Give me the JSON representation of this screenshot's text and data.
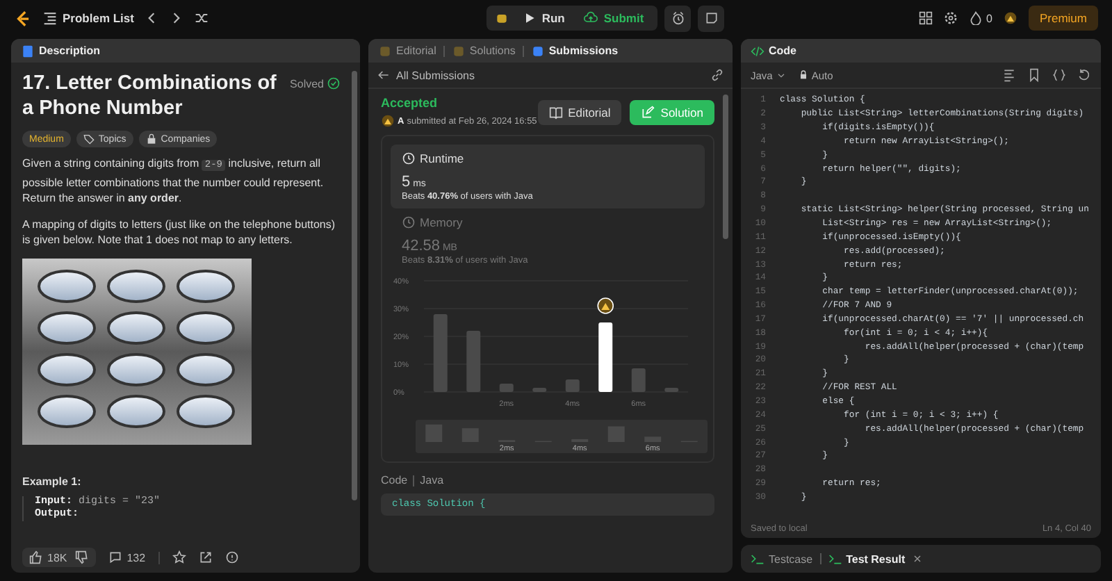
{
  "topbar": {
    "problem_list": "Problem List",
    "run": "Run",
    "submit": "Submit",
    "streak": "0",
    "premium": "Premium"
  },
  "description": {
    "tab": "Description",
    "title": "17. Letter Combinations of a Phone Number",
    "solved": "Solved",
    "tags": [
      {
        "label": "Medium",
        "kind": "difficulty"
      },
      {
        "label": "Topics",
        "kind": "topics"
      },
      {
        "label": "Companies",
        "kind": "companies"
      }
    ],
    "paragraphs": [
      [
        {
          "kind": "text",
          "text": "Given a string containing digits from "
        },
        {
          "kind": "code",
          "text": "2-9"
        },
        {
          "kind": "text",
          "text": " inclusive, return all possible letter combinations that the number could represent. Return the answer in **any order**."
        }
      ],
      [
        {
          "kind": "text",
          "text": "A mapping of digits to letters (just like on the telephone buttons) is given below. Note that 1 does not map to any letters."
        }
      ]
    ],
    "example_title": "Example 1:",
    "example_lines": [
      {
        "label": "Input:",
        "value": "digits = \"23\""
      },
      {
        "label": "Output:"
      }
    ],
    "likes": "18K",
    "comments": "132"
  },
  "submission": {
    "tabs": [
      {
        "label": "Editorial",
        "selected": false
      },
      {
        "label": "Solutions",
        "selected": false
      },
      {
        "label": "Submissions",
        "selected": true
      }
    ],
    "back": "All Submissions",
    "status": "Accepted",
    "user": "A",
    "submitted_at": "submitted at Feb 26, 2024 16:55",
    "editorial_button": "Editorial",
    "solution_button": "Solution",
    "metrics": [
      {
        "label": "Runtime",
        "value": "5",
        "unit": "ms",
        "beats_prefix": "Beats",
        "beats": "40.76%",
        "beats_suffix": "of users with Java",
        "selected": true
      },
      {
        "label": "Memory",
        "value": "42.58",
        "unit": "MB",
        "beats_prefix": "Beats",
        "beats": "8.31%",
        "beats_suffix": "of users with Java",
        "selected": false
      }
    ],
    "chart_data": {
      "type": "bar",
      "x": [
        0,
        1,
        2,
        3,
        4,
        5,
        6,
        7
      ],
      "xlim": [
        -0.5,
        7.5
      ],
      "grid": true,
      "series": [
        {
          "color": "#4a4a4a",
          "values": [
            28,
            22,
            3,
            1.5,
            4.5,
            null,
            8.5,
            1.5
          ]
        },
        {
          "color": "#ffffff",
          "values": [
            null,
            null,
            null,
            null,
            null,
            25,
            null,
            null
          ]
        }
      ],
      "ylim": [
        0,
        40
      ],
      "yticks": [
        {
          "value": 0,
          "label": "0%"
        },
        {
          "value": 10,
          "label": "10%"
        },
        {
          "value": 20,
          "label": "20%"
        },
        {
          "value": 30,
          "label": "30%"
        },
        {
          "value": 40,
          "label": "40%"
        }
      ],
      "xticks": [
        {
          "value": 2,
          "label": "2ms"
        },
        {
          "value": 4,
          "label": "4ms"
        },
        {
          "value": 6,
          "label": "6ms"
        }
      ]
    },
    "overview_labels": [
      "2ms",
      "4ms",
      "6ms"
    ],
    "code_label": "Code",
    "code_lang": "Java",
    "code_preview": "class Solution {"
  },
  "editor": {
    "tab": "Code",
    "language": "Java",
    "mode": "Auto",
    "lines": [
      {
        "number": "1",
        "text": "class Solution {"
      },
      {
        "number": "2",
        "text": "    public List<String> letterCombinations(String digits)"
      },
      {
        "number": "3",
        "text": "        if(digits.isEmpty()){"
      },
      {
        "number": "4",
        "text": "            return new ArrayList<String>();"
      },
      {
        "number": "5",
        "text": "        }"
      },
      {
        "number": "6",
        "text": "        return helper(\"\", digits);"
      },
      {
        "number": "7",
        "text": "    }"
      },
      {
        "number": "8"
      },
      {
        "number": "9",
        "text": "    static List<String> helper(String processed, String un"
      },
      {
        "number": "10",
        "text": "        List<String> res = new ArrayList<String>();"
      },
      {
        "number": "11",
        "text": "        if(unprocessed.isEmpty()){"
      },
      {
        "number": "12",
        "text": "            res.add(processed);"
      },
      {
        "number": "13",
        "text": "            return res;"
      },
      {
        "number": "14",
        "text": "        }"
      },
      {
        "number": "15",
        "text": "        char temp = letterFinder(unprocessed.charAt(0));"
      },
      {
        "number": "16",
        "text": "        //FOR 7 AND 9"
      },
      {
        "number": "17",
        "text": "        if(unprocessed.charAt(0) == '7' || unprocessed.ch"
      },
      {
        "number": "18",
        "text": "            for(int i = 0; i < 4; i++){"
      },
      {
        "number": "19",
        "text": "                res.addAll(helper(processed + (char)(temp"
      },
      {
        "number": "20",
        "text": "            }"
      },
      {
        "number": "21",
        "text": "        }"
      },
      {
        "number": "22",
        "text": "        //FOR REST ALL"
      },
      {
        "number": "23",
        "text": "        else {"
      },
      {
        "number": "24",
        "text": "            for (int i = 0; i < 3; i++) {"
      },
      {
        "number": "25",
        "text": "                res.addAll(helper(processed + (char)(temp"
      },
      {
        "number": "26",
        "text": "            }"
      },
      {
        "number": "27",
        "text": "        }"
      },
      {
        "number": "28"
      },
      {
        "number": "29",
        "text": "        return res;"
      },
      {
        "number": "30",
        "text": "    }"
      }
    ],
    "saved": "Saved to local",
    "cursor": "Ln 4, Col 40",
    "bottom_tabs": [
      {
        "label": "Testcase",
        "selected": false
      },
      {
        "label": "Test Result",
        "selected": true
      }
    ]
  }
}
